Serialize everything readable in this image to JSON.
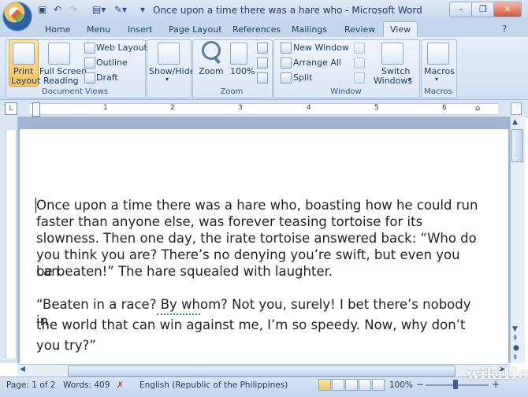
{
  "window": {
    "title": "Once upon a time there was a hare who - Microsoft Word",
    "controls": [
      "minimize",
      "restore",
      "close"
    ]
  },
  "tabs": [
    "Home",
    "Menu",
    "Insert",
    "Page Layout",
    "References",
    "Mailings",
    "Review",
    "View"
  ],
  "active_tab": "View",
  "ribbon": {
    "document_views": {
      "label": "Document Views",
      "print_layout": "Print Layout",
      "print_layout_l1": "Print",
      "print_layout_l2": "Layout",
      "full_screen_l1": "Full Screen",
      "full_screen_l2": "Reading",
      "web_layout": "Web Layout",
      "outline": "Outline",
      "draft": "Draft"
    },
    "show_hide": {
      "label": "Show/Hide"
    },
    "zoom": {
      "label": "Zoom",
      "zoom_btn": "Zoom",
      "percent_btn": "100%"
    },
    "window": {
      "label": "Window",
      "new_window": "New Window",
      "arrange_all": "Arrange All",
      "split": "Split",
      "switch_windows_l1": "Switch",
      "switch_windows_l2": "Windows"
    },
    "macros": {
      "label": "Macros",
      "macros_btn": "Macros"
    }
  },
  "ruler": {
    "numbers": [
      "1",
      "2",
      "3",
      "4",
      "5",
      "6"
    ]
  },
  "document": {
    "p1_l1": "Once upon a time there was a hare who, boasting how he could run",
    "p1_l2": "faster than anyone else, was forever teasing tortoise for its",
    "p1_l3": "slowness. Then one day, the irate tortoise answered back: “Who do",
    "p1_l4": "you think you are? There’s no denying you’re swift, but even you can",
    "p1_l5": "be beaten!” The hare squealed with laughter.",
    "p2_l1": "“Beaten in a race? By whom? Not you, surely! I bet there’s nobody in",
    "p2_l2": "the world that can win against me, I’m so speedy. Now, why don’t",
    "p2_l3": "you try?”"
  },
  "status": {
    "page": "Page: 1 of 2",
    "words": "Words: 409",
    "language": "English (Republic of the Philippines)",
    "zoom": "100%"
  },
  "watermark": "wikiHow"
}
